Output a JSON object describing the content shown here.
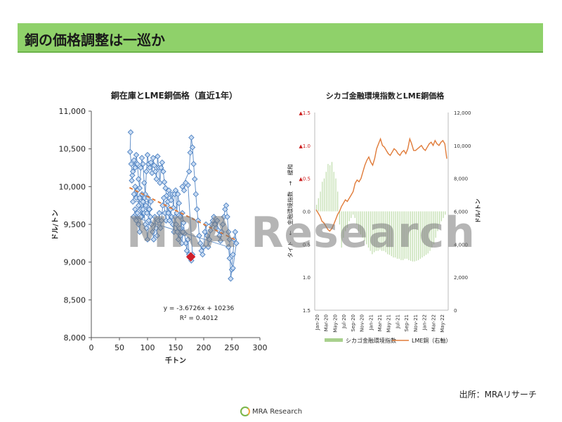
{
  "header": {
    "title": "銅の価格調整は一巡か"
  },
  "watermark": "MRA Research",
  "source": "出所：MRAリサーチ",
  "footer": {
    "logo_text": "MRA Research"
  },
  "chart_data": [
    {
      "type": "scatter",
      "title": "銅在庫とLME銅価格（直近1年）",
      "xlabel": "千トン",
      "ylabel": "ドル/トン",
      "xlim": [
        0,
        300
      ],
      "ylim": [
        8000,
        11000
      ],
      "xticks": [
        0,
        50,
        100,
        150,
        200,
        250,
        300
      ],
      "yticks": [
        8000,
        8500,
        9000,
        9500,
        10000,
        10500,
        11000
      ],
      "ytick_labels": [
        "8,000",
        "8,500",
        "9,000",
        "9,500",
        "10,000",
        "10,500",
        "11,000"
      ],
      "trend_equation": "y = -3.6726x + 10236",
      "r2_text": "R² = 0.4012",
      "trend": {
        "slope": -3.6726,
        "intercept": 10236,
        "x_range": [
          68,
          258
        ],
        "color": "#e07b39"
      },
      "marker_color": "#4a7fc1",
      "latest_point": {
        "x": 177,
        "y": 9070,
        "color": "#d0202a"
      },
      "points": [
        [
          70,
          10720
        ],
        [
          69,
          10460
        ],
        [
          71,
          10300
        ],
        [
          73,
          10150
        ],
        [
          72,
          10080
        ],
        [
          74,
          10200
        ],
        [
          76,
          10350
        ],
        [
          78,
          10250
        ],
        [
          80,
          10420
        ],
        [
          82,
          10300
        ],
        [
          84,
          10100
        ],
        [
          86,
          9980
        ],
        [
          88,
          10250
        ],
        [
          90,
          10380
        ],
        [
          92,
          10300
        ],
        [
          94,
          10050
        ],
        [
          96,
          9900
        ],
        [
          98,
          10200
        ],
        [
          100,
          10420
        ],
        [
          102,
          10300
        ],
        [
          104,
          10250
        ],
        [
          106,
          10320
        ],
        [
          108,
          10180
        ],
        [
          110,
          10380
        ],
        [
          112,
          10280
        ],
        [
          114,
          10200
        ],
        [
          116,
          10100
        ],
        [
          118,
          10400
        ],
        [
          120,
          10250
        ],
        [
          122,
          10050
        ],
        [
          124,
          10250
        ],
        [
          126,
          10320
        ],
        [
          128,
          10200
        ],
        [
          130,
          10060
        ],
        [
          132,
          9980
        ],
        [
          134,
          9880
        ],
        [
          136,
          9800
        ],
        [
          138,
          9950
        ],
        [
          140,
          9900
        ],
        [
          142,
          9820
        ],
        [
          144,
          9900
        ],
        [
          146,
          9720
        ],
        [
          148,
          9900
        ],
        [
          150,
          9950
        ],
        [
          152,
          9650
        ],
        [
          154,
          9900
        ],
        [
          156,
          9780
        ],
        [
          158,
          9600
        ],
        [
          160,
          9450
        ],
        [
          162,
          9650
        ],
        [
          164,
          9520
        ],
        [
          166,
          9380
        ],
        [
          168,
          9250
        ],
        [
          170,
          9150
        ],
        [
          172,
          9300
        ],
        [
          174,
          9100
        ],
        [
          176,
          9050
        ],
        [
          178,
          9020
        ],
        [
          180,
          9100
        ],
        [
          172,
          10020
        ],
        [
          168,
          10050
        ],
        [
          165,
          9950
        ],
        [
          162,
          10000
        ],
        [
          174,
          10200
        ],
        [
          176,
          10450
        ],
        [
          178,
          10650
        ],
        [
          180,
          10520
        ],
        [
          182,
          10300
        ],
        [
          184,
          10100
        ],
        [
          186,
          9900
        ],
        [
          188,
          9700
        ],
        [
          190,
          9550
        ],
        [
          192,
          9350
        ],
        [
          194,
          9250
        ],
        [
          196,
          9150
        ],
        [
          198,
          9100
        ],
        [
          200,
          9200
        ],
        [
          202,
          9400
        ],
        [
          204,
          9500
        ],
        [
          206,
          9350
        ],
        [
          208,
          9200
        ],
        [
          210,
          9300
        ],
        [
          212,
          9420
        ],
        [
          214,
          9500
        ],
        [
          216,
          9550
        ],
        [
          218,
          9600
        ],
        [
          220,
          9500
        ],
        [
          222,
          9450
        ],
        [
          224,
          9550
        ],
        [
          226,
          9420
        ],
        [
          228,
          9350
        ],
        [
          230,
          9280
        ],
        [
          232,
          9400
        ],
        [
          234,
          9500
        ],
        [
          236,
          9600
        ],
        [
          238,
          9700
        ],
        [
          240,
          9750
        ],
        [
          242,
          9600
        ],
        [
          244,
          9400
        ],
        [
          246,
          9300
        ],
        [
          248,
          8780
        ],
        [
          250,
          8900
        ],
        [
          252,
          9100
        ],
        [
          254,
          9300
        ],
        [
          256,
          9400
        ],
        [
          258,
          9250
        ],
        [
          252,
          8920
        ],
        [
          246,
          9050
        ],
        [
          244,
          9200
        ],
        [
          75,
          9600
        ],
        [
          78,
          9700
        ],
        [
          80,
          9550
        ],
        [
          82,
          9650
        ],
        [
          84,
          9500
        ],
        [
          86,
          9400
        ],
        [
          88,
          9700
        ],
        [
          90,
          9600
        ],
        [
          92,
          9800
        ],
        [
          94,
          9650
        ],
        [
          96,
          9500
        ],
        [
          98,
          9450
        ],
        [
          100,
          9300
        ],
        [
          102,
          9550
        ],
        [
          104,
          9700
        ],
        [
          106,
          9800
        ],
        [
          74,
          9800
        ],
        [
          76,
          9900
        ],
        [
          78,
          10000
        ],
        [
          80,
          9850
        ],
        [
          82,
          9950
        ],
        [
          84,
          9750
        ],
        [
          86,
          9850
        ],
        [
          88,
          9600
        ],
        [
          90,
          9900
        ],
        [
          92,
          9700
        ],
        [
          95,
          9850
        ],
        [
          97,
          9750
        ],
        [
          99,
          9650
        ],
        [
          101,
          9850
        ],
        [
          103,
          9700
        ],
        [
          105,
          9600
        ],
        [
          107,
          9500
        ],
        [
          109,
          9400
        ],
        [
          111,
          9300
        ],
        [
          113,
          9600
        ],
        [
          115,
          9450
        ],
        [
          117,
          9350
        ],
        [
          119,
          9550
        ],
        [
          121,
          9650
        ],
        [
          123,
          9450
        ],
        [
          125,
          9550
        ],
        [
          127,
          9750
        ],
        [
          129,
          9850
        ],
        [
          131,
          9650
        ],
        [
          133,
          9550
        ],
        [
          135,
          9750
        ],
        [
          137,
          9650
        ],
        [
          139,
          9550
        ],
        [
          141,
          9700
        ],
        [
          143,
          9600
        ],
        [
          145,
          9500
        ],
        [
          147,
          9400
        ],
        [
          149,
          9600
        ],
        [
          151,
          9500
        ],
        [
          153,
          9400
        ],
        [
          155,
          9300
        ],
        [
          157,
          9450
        ],
        [
          159,
          9350
        ],
        [
          161,
          9250
        ],
        [
          163,
          9400
        ]
      ]
    },
    {
      "type": "bar+line",
      "title": "シカゴ金融環境指数とLME銅価格",
      "ylabel_left": "タイト　←　金融環境指数　→　緩和",
      "ylabel_right": "ドル/トン",
      "left_ticks": [
        "▲1.5",
        "▲1.0",
        "▲0.5",
        "0.0",
        "0.5",
        "1.0",
        "1.5"
      ],
      "left_tick_values": [
        -1.5,
        -1.0,
        -0.5,
        0.0,
        0.5,
        1.0,
        1.5
      ],
      "left_red_ticks": [
        true,
        true,
        true,
        false,
        false,
        false,
        false
      ],
      "right_ticks": [
        "0",
        "2,000",
        "4,000",
        "6,000",
        "8,000",
        "10,000",
        "12,000"
      ],
      "right_tick_values": [
        0,
        2000,
        4000,
        6000,
        8000,
        10000,
        12000
      ],
      "x_labels": [
        "Jan-20",
        "Mar-20",
        "May-20",
        "Jul-20",
        "Sep-20",
        "Nov-20",
        "Jan-21",
        "Mar-21",
        "May-21",
        "Jul-21",
        "Sep-21",
        "Nov-21",
        "Jan-22",
        "Mar-22",
        "May-22"
      ],
      "legend": [
        "シカゴ金融環境指数",
        "LME銅（右軸）"
      ],
      "bar_color": "#a8d08d",
      "line_color": "#e07b39",
      "series": [
        {
          "name": "シカゴ金融環境指数",
          "values": [
            -0.1,
            -0.2,
            -0.3,
            -0.45,
            -0.5,
            -0.6,
            -0.72,
            -0.7,
            -0.75,
            -0.6,
            -0.5,
            -0.3,
            0.2,
            0.55,
            0.4,
            0.3,
            0.25,
            0.15,
            0.1,
            0.05,
            0.1,
            0.2,
            0.3,
            0.35,
            0.4,
            0.45,
            0.5,
            0.55,
            0.6,
            0.65,
            0.62,
            0.6,
            0.6,
            0.58,
            0.6,
            0.6,
            0.62,
            0.65,
            0.66,
            0.68,
            0.7,
            0.7,
            0.72,
            0.72,
            0.74,
            0.74,
            0.72,
            0.72,
            0.74,
            0.75,
            0.76,
            0.76,
            0.75,
            0.74,
            0.72,
            0.7,
            0.68,
            0.66,
            0.64,
            0.6,
            0.55,
            0.5,
            0.4,
            0.3,
            0.2,
            0.15,
            0.1,
            0.05
          ]
        },
        {
          "name": "LME銅（右軸）",
          "values": [
            6100,
            5900,
            5700,
            5400,
            5300,
            5100,
            4900,
            4800,
            4950,
            5200,
            5500,
            5800,
            6000,
            6300,
            6500,
            6700,
            6600,
            6800,
            7000,
            7200,
            7700,
            7900,
            7800,
            8000,
            8400,
            8800,
            9100,
            9300,
            9000,
            8800,
            9200,
            9800,
            10100,
            10400,
            10000,
            9900,
            9700,
            9500,
            9400,
            9600,
            9800,
            9700,
            9500,
            9400,
            9600,
            9700,
            9500,
            9800,
            10400,
            10100,
            9700,
            9700,
            9800,
            9900,
            10000,
            9800,
            9700,
            9900,
            10100,
            10200,
            10000,
            10300,
            10100,
            10000,
            10200,
            10300,
            10100,
            9200
          ]
        }
      ]
    }
  ]
}
